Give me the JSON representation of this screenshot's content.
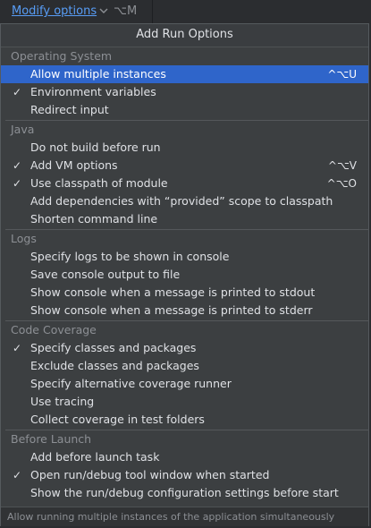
{
  "topbar": {
    "link": "Modify options",
    "chevron_icon": "chevron-down-icon",
    "shortcut": "⌥M"
  },
  "popup": {
    "title": "Add Run Options",
    "sections": [
      {
        "header": "Operating System",
        "items": [
          {
            "label": "Allow multiple instances",
            "checked": false,
            "shortcut": "^⌥U",
            "selected": true
          },
          {
            "label": "Environment variables",
            "checked": true,
            "shortcut": ""
          },
          {
            "label": "Redirect input",
            "checked": false,
            "shortcut": ""
          }
        ]
      },
      {
        "header": "Java",
        "items": [
          {
            "label": "Do not build before run",
            "checked": false,
            "shortcut": ""
          },
          {
            "label": "Add VM options",
            "checked": true,
            "shortcut": "^⌥V"
          },
          {
            "label": "Use classpath of module",
            "checked": true,
            "shortcut": "^⌥O"
          },
          {
            "label": "Add dependencies with “provided” scope to classpath",
            "checked": false,
            "shortcut": ""
          },
          {
            "label": "Shorten command line",
            "checked": false,
            "shortcut": ""
          }
        ]
      },
      {
        "header": "Logs",
        "items": [
          {
            "label": "Specify logs to be shown in console",
            "checked": false,
            "shortcut": ""
          },
          {
            "label": "Save console output to file",
            "checked": false,
            "shortcut": ""
          },
          {
            "label": "Show console when a message is printed to stdout",
            "checked": false,
            "shortcut": ""
          },
          {
            "label": "Show console when a message is printed to stderr",
            "checked": false,
            "shortcut": ""
          }
        ]
      },
      {
        "header": "Code Coverage",
        "items": [
          {
            "label": "Specify classes and packages",
            "checked": true,
            "shortcut": ""
          },
          {
            "label": "Exclude classes and packages",
            "checked": false,
            "shortcut": ""
          },
          {
            "label": "Specify alternative coverage runner",
            "checked": false,
            "shortcut": ""
          },
          {
            "label": "Use tracing",
            "checked": false,
            "shortcut": ""
          },
          {
            "label": "Collect coverage in test folders",
            "checked": false,
            "shortcut": ""
          }
        ]
      },
      {
        "header": "Before Launch",
        "items": [
          {
            "label": "Add before launch task",
            "checked": false,
            "shortcut": ""
          },
          {
            "label": "Open run/debug tool window when started",
            "checked": true,
            "shortcut": ""
          },
          {
            "label": "Show the run/debug configuration settings before start",
            "checked": false,
            "shortcut": ""
          }
        ]
      }
    ],
    "check_glyph": "✓",
    "footer": "Allow running multiple instances of the application simultaneously"
  }
}
